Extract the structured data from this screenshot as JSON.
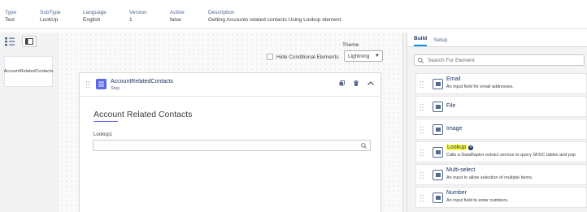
{
  "meta": {
    "columns": [
      {
        "label": "Type",
        "value": "Test"
      },
      {
        "label": "SubType",
        "value": "LookUp"
      },
      {
        "label": "Language",
        "value": "English"
      },
      {
        "label": "Version",
        "value": "1"
      },
      {
        "label": "Active",
        "value": "false"
      },
      {
        "label": "Description",
        "value": "Getting Accounts related contacts Using Lookup element."
      }
    ]
  },
  "left_panel": {
    "card_label": "AccountRelatedContacts"
  },
  "canvas": {
    "theme_label": "Theme",
    "theme_value": "Lightning",
    "hide_conditional_label": "Hide Conditional Elements",
    "step": {
      "name": "AccountRelatedContacts",
      "type": "Step",
      "section_title": "Account Related Contacts",
      "lookup_label": "Lookup1",
      "lookup_value": ""
    }
  },
  "right_panel": {
    "tabs": [
      "Build",
      "Setup"
    ],
    "active_tab": "Build",
    "search_placeholder": "Search For Element",
    "elements": [
      {
        "name": "Email",
        "desc": "An input field for email addresses."
      },
      {
        "name": "File",
        "desc": ""
      },
      {
        "name": "Image",
        "desc": ""
      },
      {
        "name": "Lookup",
        "desc": "Calls a DataRaptor extract service to query SFDC tables and pop"
      },
      {
        "name": "Multi-select",
        "desc": "An input to allow selection of multiple items."
      },
      {
        "name": "Number",
        "desc": "An input field to enter numbers."
      }
    ]
  },
  "colors": {
    "accent": "#5867e8",
    "tab_underline": "#1589ee",
    "highlight": "#ffff3d"
  }
}
